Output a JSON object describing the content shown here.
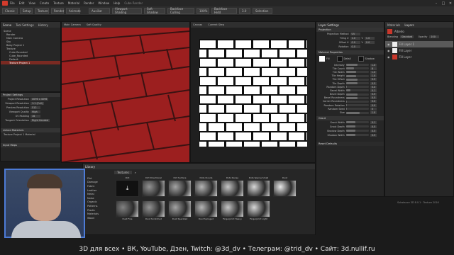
{
  "menu": {
    "items": [
      "File",
      "Edit",
      "View",
      "Create",
      "Texture",
      "Material",
      "Render",
      "Window",
      "Help",
      "Cube Render"
    ]
  },
  "toolbar": {
    "render_label": "Auxiliar",
    "viewport_shading": "Viewport Shading",
    "soft_shadows": "Soft Shadow",
    "backface_culling": "Backface Culling",
    "zoom": "100%",
    "backface_hide": "Backface Hidd",
    "value1": "3.0",
    "selection": "Selection"
  },
  "left_panel": {
    "tabs": [
      "Scene",
      "Tool Settings",
      "History"
    ],
    "tree": [
      "Scene",
      "Render",
      "Main Camera",
      "Sky",
      "Baby Project 1",
      "Texture",
      "Cube Rounded",
      "Cube_Rounded",
      "Default",
      "Texture Project 1"
    ],
    "selected_index": 9,
    "project_settings_title": "Project Settings",
    "props": [
      {
        "label": "Project Resolution",
        "value": "4096 x 4096"
      },
      {
        "label": "Viewport Resolution",
        "value": "1:1 (Full)"
      },
      {
        "label": "Preview Resolution",
        "value": "512"
      },
      {
        "label": "Viewport Quality",
        "value": "High"
      },
      {
        "label": "UV Padding",
        "value": "16"
      },
      {
        "label": "Tangent Orientation",
        "value": "Right Handed"
      }
    ],
    "linked_title": "Linked Materials",
    "linked_item": "Texture Project 1 Material",
    "input_title": "Input Maps"
  },
  "viewport_3d": {
    "tabs": [
      "Main Camera",
      "Soft Quality"
    ]
  },
  "viewport_2d": {
    "tabs": [
      "Canvas",
      "Current Step"
    ]
  },
  "layer_settings": {
    "title": "Layer Settings",
    "projection_title": "Projection",
    "projection_method_label": "Projection Method",
    "projection_method": "UV",
    "tiling_u": "1.0",
    "tiling_v": "1.0",
    "offset_u": "0.0",
    "offset_v": "0.0",
    "rotation": "0.0",
    "material_title": "Material Properties",
    "checkbox_labels": [
      "Fill",
      "Detail",
      "Shadow"
    ],
    "params": [
      {
        "label": "Intensity",
        "value": "1.0",
        "fill": 0.5
      },
      {
        "label": "Tile Count",
        "value": "8",
        "fill": 0.35
      },
      {
        "label": "Tile Width",
        "value": "1.0",
        "fill": 0.45
      },
      {
        "label": "Tile Height",
        "value": "1.0",
        "fill": 0.45
      },
      {
        "label": "Tile Offset",
        "value": "0.5",
        "fill": 0.5
      },
      {
        "label": "Tile Depth",
        "value": "0.5",
        "fill": 0.5
      },
      {
        "label": "Random Depth",
        "value": "0.0",
        "fill": 0.05
      },
      {
        "label": "Bevel Width",
        "value": "0.1",
        "fill": 0.2
      },
      {
        "label": "Bevel Depth",
        "value": "0.5",
        "fill": 0.5
      },
      {
        "label": "Bevel Roundness",
        "value": "0.5",
        "fill": 0.5
      },
      {
        "label": "Corner Roundness",
        "value": "0.0",
        "fill": 0.05
      },
      {
        "label": "Random Rotation",
        "value": "0.0",
        "fill": 0.05
      },
      {
        "label": "Random Seed",
        "value": "0",
        "fill": 0.05
      },
      {
        "label": "Size",
        "value": "1.0",
        "fill": 0.6
      }
    ],
    "grout_title": "Grout",
    "grout_params": [
      {
        "label": "Grout Width",
        "value": "0.1"
      },
      {
        "label": "Grout Depth",
        "value": "0.5"
      },
      {
        "label": "Shadow Depth",
        "value": "0.5"
      },
      {
        "label": "Shadow Width",
        "value": "0.5"
      }
    ],
    "reset_label": "Reset Defaults"
  },
  "layers_panel": {
    "tabs": [
      "Materials",
      "Layers"
    ],
    "material_name": "Albedo",
    "blend_label": "Blending",
    "blend_value": "Standard",
    "opacity_label": "Opacity",
    "opacity_value": "100",
    "layers": [
      "Fill Layer 1",
      "Fill Layer",
      "Fill Layer"
    ]
  },
  "library": {
    "title": "Library",
    "category": "Textures",
    "row1": [
      "Dirt",
      "Dirt Directional",
      "Dirt Surface",
      "Dots Clouds",
      "Dots Dense",
      "Dots Sparse Small",
      "Dust"
    ],
    "row2": [
      "Dust Fine",
      "Dust Scratched",
      "Dust Speckled",
      "Dust Sponged",
      "Fingerprint Heavy",
      "Fingerprint Light"
    ],
    "folders": [
      "Dirt",
      "Damage",
      "Fabric",
      "Leather",
      "Metal",
      "Noise",
      "Organic",
      "Patterns",
      "Plastic",
      "Materials",
      "Wood"
    ]
  },
  "status": {
    "text": "Substance 3D 8.0.1 · Texture 2016"
  },
  "caption": {
    "text": "3D для всех    •  ВК, YouTube, Дзен, Twitch: @3d_dv   •  Телеграм: @trid_dv   •  Сайт: 3d.nullif.ru"
  },
  "colors": {
    "accent_red": "#c8372b",
    "brick_red": "#9c1f1f"
  }
}
